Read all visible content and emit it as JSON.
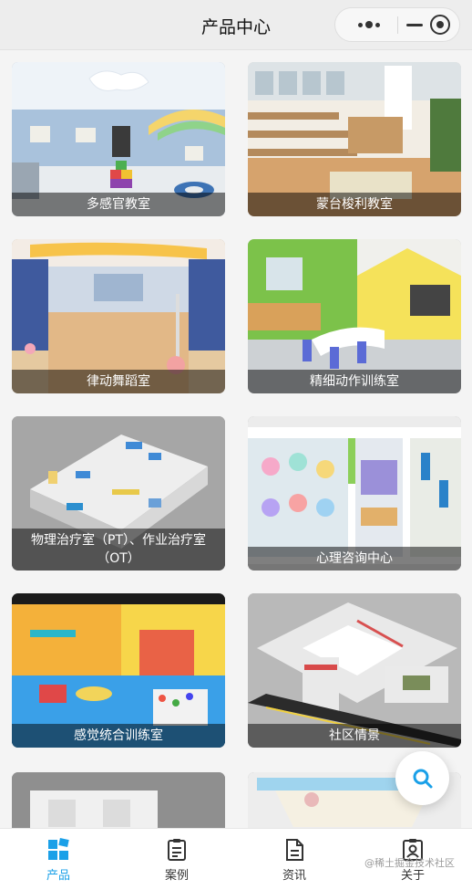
{
  "navbar": {
    "title": "产品中心"
  },
  "capsule": {
    "more_icon": "more-dots-icon",
    "minimize_icon": "minimize-icon",
    "close_icon": "target-close-icon"
  },
  "products": [
    {
      "title": "多感官教室"
    },
    {
      "title": "蒙台梭利教室"
    },
    {
      "title": "律动舞蹈室"
    },
    {
      "title": "精细动作训练室"
    },
    {
      "title": "物理治疗室（PT）、作业治疗室（OT）"
    },
    {
      "title": "心理咨询中心"
    },
    {
      "title": "感觉统合训练室"
    },
    {
      "title": "社区情景"
    }
  ],
  "fab": {
    "icon": "search-icon"
  },
  "tabbar": {
    "tabs": [
      {
        "label": "产品",
        "icon": "grid-icon",
        "active": true
      },
      {
        "label": "案例",
        "icon": "clipboard-icon",
        "active": false
      },
      {
        "label": "资讯",
        "icon": "document-icon",
        "active": false
      },
      {
        "label": "关于",
        "icon": "badge-icon",
        "active": false
      }
    ]
  },
  "watermark": "@稀土掘金技术社区",
  "colors": {
    "accent": "#1aa0e8",
    "navbar_bg": "#ededed",
    "caption_bg": "rgba(0,0,0,0.5)"
  }
}
